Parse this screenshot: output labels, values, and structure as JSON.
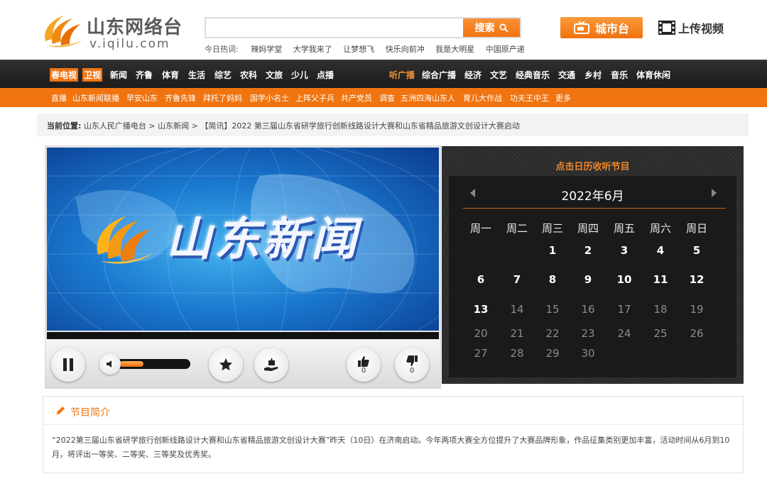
{
  "header": {
    "logo_title": "山东网络台",
    "logo_url": "v.iqilu.com",
    "search": {
      "placeholder": "",
      "button_label": "搜索"
    },
    "hot_label": "今日热词:",
    "hot_words": [
      "辣妈学堂",
      "大学我来了",
      "让梦想飞",
      "快乐向前冲",
      "我是大明星",
      "中国原产递"
    ],
    "city_button": "城市台",
    "upload_button": "上传视频"
  },
  "nav": {
    "tv_items": [
      "春电视",
      "卫视",
      "新闻",
      "齐鲁",
      "体育",
      "生活",
      "综艺",
      "农科",
      "文旅",
      "少儿",
      "点播"
    ],
    "radio_items": [
      "听广播",
      "综合广播",
      "经济",
      "文艺",
      "经典音乐",
      "交通",
      "乡村",
      "音乐",
      "体育休闲"
    ]
  },
  "subnav": {
    "items": [
      "直播",
      "山东新闻联播",
      "早安山东",
      "齐鲁先锋",
      "拜托了妈妈",
      "国学小名士",
      "上阵父子兵",
      "共产党员",
      "调查",
      "五洲四海山东人",
      "育儿大作战",
      "功夫王中王",
      "更多"
    ]
  },
  "breadcrumb": {
    "label": "当前位置:",
    "path": "山东人民广播电台 > 山东新闻 > 【简讯】2022 第三届山东省研学旅行创新线路设计大赛和山东省精品旅游文创设计大赛启动"
  },
  "player": {
    "video_title": "山东新闻",
    "volume_level": 0.35,
    "like_count": "0",
    "dislike_count": "0",
    "colors": {
      "accent": "#f07410"
    }
  },
  "calendar": {
    "header": "点击日历收听节目",
    "month": "2022年6月",
    "weekdays": [
      "周一",
      "周二",
      "周三",
      "周四",
      "周五",
      "周六",
      "周日"
    ],
    "weeks": [
      [
        null,
        null,
        "1",
        "2",
        "3",
        "4",
        "5"
      ],
      [
        "6",
        "7",
        "8",
        "9",
        "10",
        "11",
        "12"
      ],
      [
        "13",
        "14",
        "15",
        "16",
        "17",
        "18",
        "19"
      ],
      [
        "20",
        "21",
        "22",
        "23",
        "24",
        "25",
        "26"
      ],
      [
        "27",
        "28",
        "29",
        "30",
        null,
        null,
        null
      ]
    ],
    "last_active_day": 13
  },
  "intro": {
    "title": "节目简介",
    "text": "“2022第三届山东省研学旅行创新线路设计大赛和山东省精品旅游文创设计大赛”昨天（10日）在济南启动。今年两项大赛全方位提升了大赛品牌形象，作品征集类别更加丰富，活动时间从6月到10月，将评出一等奖、二等奖、三等奖及优秀奖。"
  }
}
